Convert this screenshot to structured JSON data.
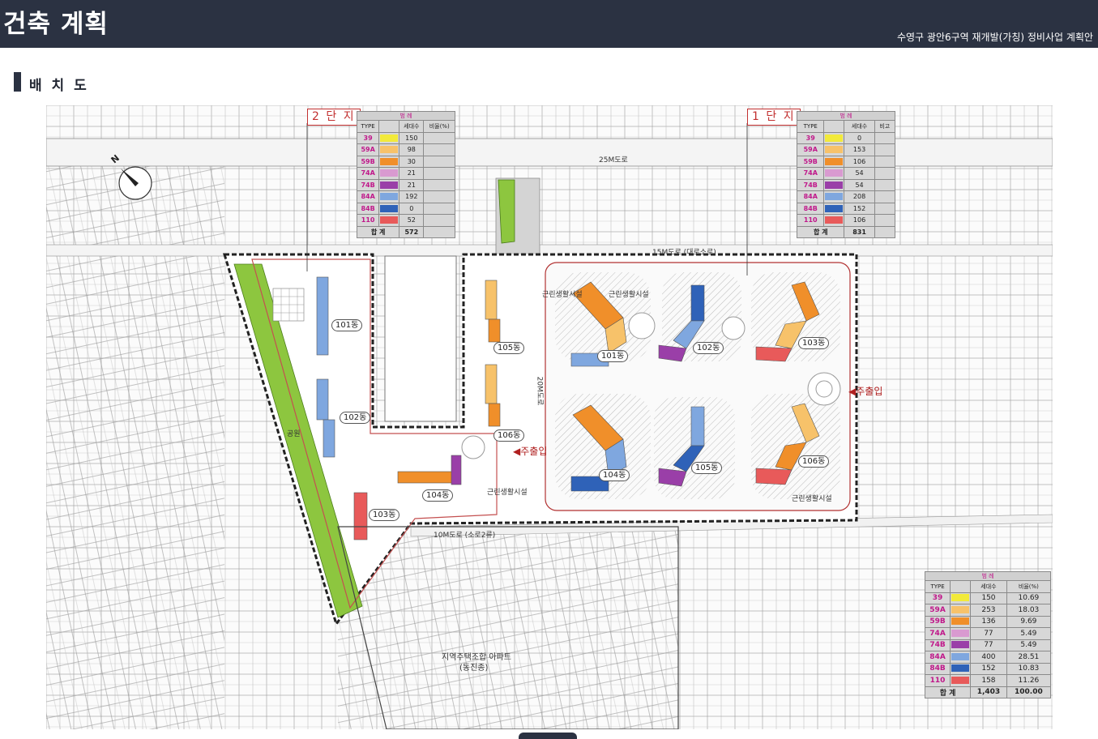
{
  "header": {
    "title": "건축 계획",
    "subtitle": "수영구 광안6구역 재개발(가칭) 정비사업 계획안"
  },
  "section": {
    "title": "배 치 도"
  },
  "map": {
    "complex2_tag": "2 단 지",
    "complex1_tag": "1 단 지",
    "road_25m": "25M도로",
    "road_15m": "15M도로 (대로소로)",
    "road_10m_bottom": "10M도로 (소로2류)",
    "park_label": "공원",
    "central_road": "20M도로",
    "main_entrance_center": "주출입",
    "main_entrance_east": "주출입",
    "facility_left": "근린생활시설",
    "facility_right": "근린생활시설",
    "facility_1_top": "근린생활시설",
    "facility_1_bottom": "근린생활시설",
    "neighbor_apartment": "지역주택조합 아파트",
    "neighbor_apartment_sub": "(동진종)",
    "complex2_buildings": [
      "101동",
      "102동",
      "103동",
      "104동",
      "105동",
      "106동"
    ],
    "complex1_buildings": [
      "101동",
      "102동",
      "103동",
      "104동",
      "105동",
      "106동"
    ]
  },
  "legend_header": {
    "title": "범 례",
    "col_type": "TYPE",
    "col_units": "세대수",
    "col_ratio": "비율(%)",
    "col_note": "비고",
    "total_label": "합 계"
  },
  "legend_complex2": {
    "rows": [
      {
        "type": "39",
        "color": "#f2ea3a",
        "units": "150"
      },
      {
        "type": "59A",
        "color": "#f7c26a",
        "units": "98"
      },
      {
        "type": "59B",
        "color": "#f08f2a",
        "units": "30"
      },
      {
        "type": "74A",
        "color": "#d99ad0",
        "units": "21"
      },
      {
        "type": "74B",
        "color": "#9a3fa8",
        "units": "21"
      },
      {
        "type": "84A",
        "color": "#7fa7df",
        "units": "192"
      },
      {
        "type": "84B",
        "color": "#2f62b8",
        "units": "0"
      },
      {
        "type": "110",
        "color": "#e85a5a",
        "units": "52"
      }
    ],
    "total": "572"
  },
  "legend_complex1": {
    "rows": [
      {
        "type": "39",
        "color": "#f2ea3a",
        "units": "0"
      },
      {
        "type": "59A",
        "color": "#f7c26a",
        "units": "153"
      },
      {
        "type": "59B",
        "color": "#f08f2a",
        "units": "106"
      },
      {
        "type": "74A",
        "color": "#d99ad0",
        "units": "54"
      },
      {
        "type": "74B",
        "color": "#9a3fa8",
        "units": "54"
      },
      {
        "type": "84A",
        "color": "#7fa7df",
        "units": "208"
      },
      {
        "type": "84B",
        "color": "#2f62b8",
        "units": "152"
      },
      {
        "type": "110",
        "color": "#e85a5a",
        "units": "106"
      }
    ],
    "total": "831"
  },
  "legend_total": {
    "rows": [
      {
        "type": "39",
        "color": "#f2ea3a",
        "units": "150",
        "ratio": "10.69"
      },
      {
        "type": "59A",
        "color": "#f7c26a",
        "units": "253",
        "ratio": "18.03"
      },
      {
        "type": "59B",
        "color": "#f08f2a",
        "units": "136",
        "ratio": "9.69"
      },
      {
        "type": "74A",
        "color": "#d99ad0",
        "units": "77",
        "ratio": "5.49"
      },
      {
        "type": "74B",
        "color": "#9a3fa8",
        "units": "77",
        "ratio": "5.49"
      },
      {
        "type": "84A",
        "color": "#7fa7df",
        "units": "400",
        "ratio": "28.51"
      },
      {
        "type": "84B",
        "color": "#2f62b8",
        "units": "152",
        "ratio": "10.83"
      },
      {
        "type": "110",
        "color": "#e85a5a",
        "units": "158",
        "ratio": "11.26"
      }
    ],
    "total_units": "1,403",
    "total_ratio": "100.00"
  }
}
